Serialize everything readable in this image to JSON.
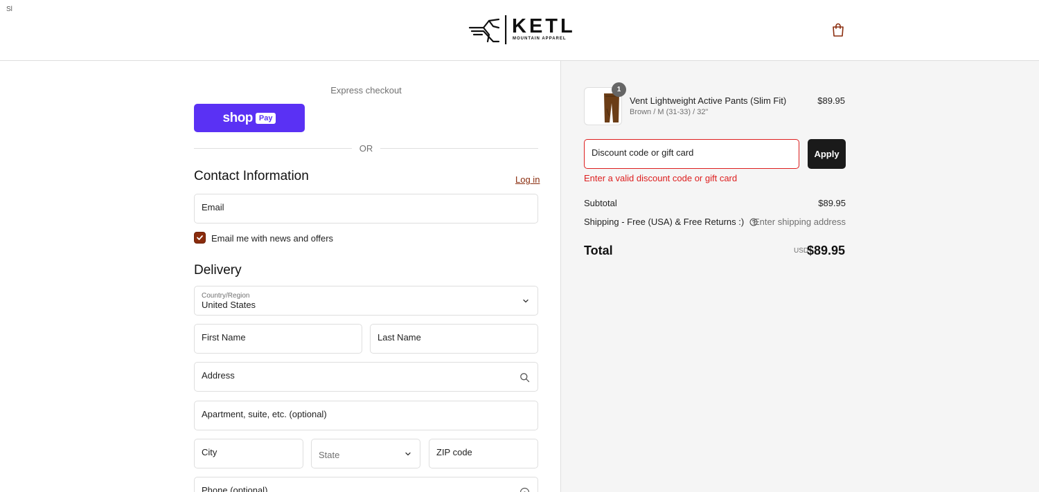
{
  "header": {
    "corner_glyph": "Sl",
    "brand_name": "KETL",
    "brand_tagline": "MOUNTAIN APPAREL",
    "cart_icon": "shopping-bag-icon"
  },
  "express": {
    "label": "Express checkout",
    "shop_text": "shop",
    "pay_text": "Pay",
    "or_text": "OR"
  },
  "contact": {
    "title": "Contact Information",
    "login_link": "Log in",
    "email_placeholder": "Email",
    "newsletter_label": "Email me with news and offers",
    "newsletter_checked": true
  },
  "delivery": {
    "title": "Delivery",
    "country_label": "Country/Region",
    "country_value": "United States",
    "first_name_placeholder": "First Name",
    "last_name_placeholder": "Last Name",
    "address_placeholder": "Address",
    "apartment_placeholder": "Apartment, suite, etc. (optional)",
    "city_placeholder": "City",
    "state_placeholder": "State",
    "zip_placeholder": "ZIP code",
    "phone_placeholder": "Phone (optional)"
  },
  "summary": {
    "item": {
      "quantity": "1",
      "name": "Vent Lightweight Active Pants (Slim Fit)",
      "variant": "Brown / M (31-33) / 32\"",
      "price": "$89.95"
    },
    "discount_placeholder": "Discount code or gift card",
    "apply_label": "Apply",
    "discount_error": "Enter a valid discount code or gift card",
    "subtotal_label": "Subtotal",
    "subtotal_value": "$89.95",
    "shipping_label": "Shipping - Free (USA) & Free Returns :)",
    "shipping_value": "Enter shipping address",
    "total_label": "Total",
    "total_currency": "USD",
    "total_value": "$89.95"
  },
  "colors": {
    "accent": "#8a2c0d",
    "shop_pay": "#5a31f4",
    "error": "#dd1d1d",
    "apply_button": "#1a1a1a"
  }
}
